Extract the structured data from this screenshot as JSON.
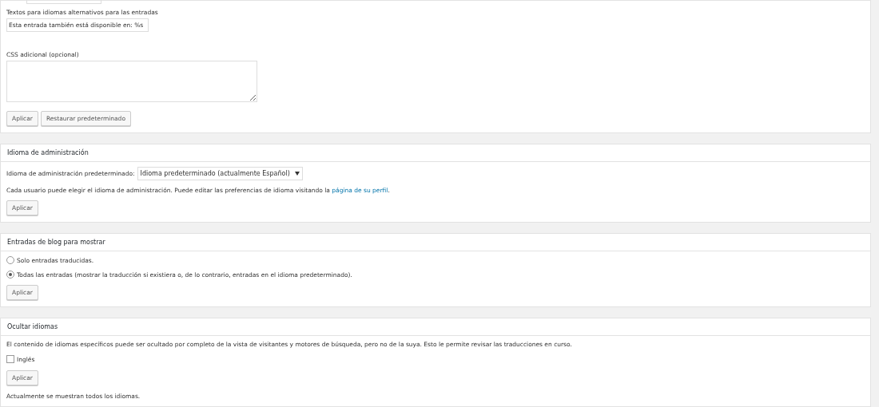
{
  "top_panel": {
    "alt_text_label": "Textos para idiomas alternativos para las entradas",
    "alt_text_value": "Esta entrada también está disponible en: %s",
    "css_label": "CSS adicional (opcional)",
    "buttons": [
      "Aplicar",
      "Restaurar predeterminado"
    ]
  },
  "admin_panel": {
    "title": "Idioma de administración",
    "select_label": "Idioma de administración predeterminado:",
    "select_value": "Idioma predeterminado (actualmente Español)",
    "help_text": "Cada usuario puede elegir el idioma de administración. Puede editar las preferencias de idioma visitando la",
    "help_link": "página de su perfil",
    "help_end": ".",
    "button": "Aplicar"
  },
  "posts_panel": {
    "title": "Entradas de blog para mostrar",
    "options": [
      {
        "label": "Solo entradas traducidas.",
        "selected": false
      },
      {
        "label": "Todas las entradas (mostrar la traducción si existiera o, de lo contrario, entradas en el idioma predeterminado).",
        "selected": true
      }
    ],
    "button": "Aplicar"
  },
  "hide_panel": {
    "title": "Ocultar idiomas",
    "description": "El contenido de idiomas específicos puede ser ocultado por completo de la vista de visitantes y motores de búsqueda, pero no de la suya. Esto le permite revisar las traducciones en curso.",
    "languages": [
      {
        "label": "Inglés",
        "checked": false
      }
    ],
    "button": "Aplicar",
    "status": "Actualmente se muestran todos los idiomas."
  }
}
